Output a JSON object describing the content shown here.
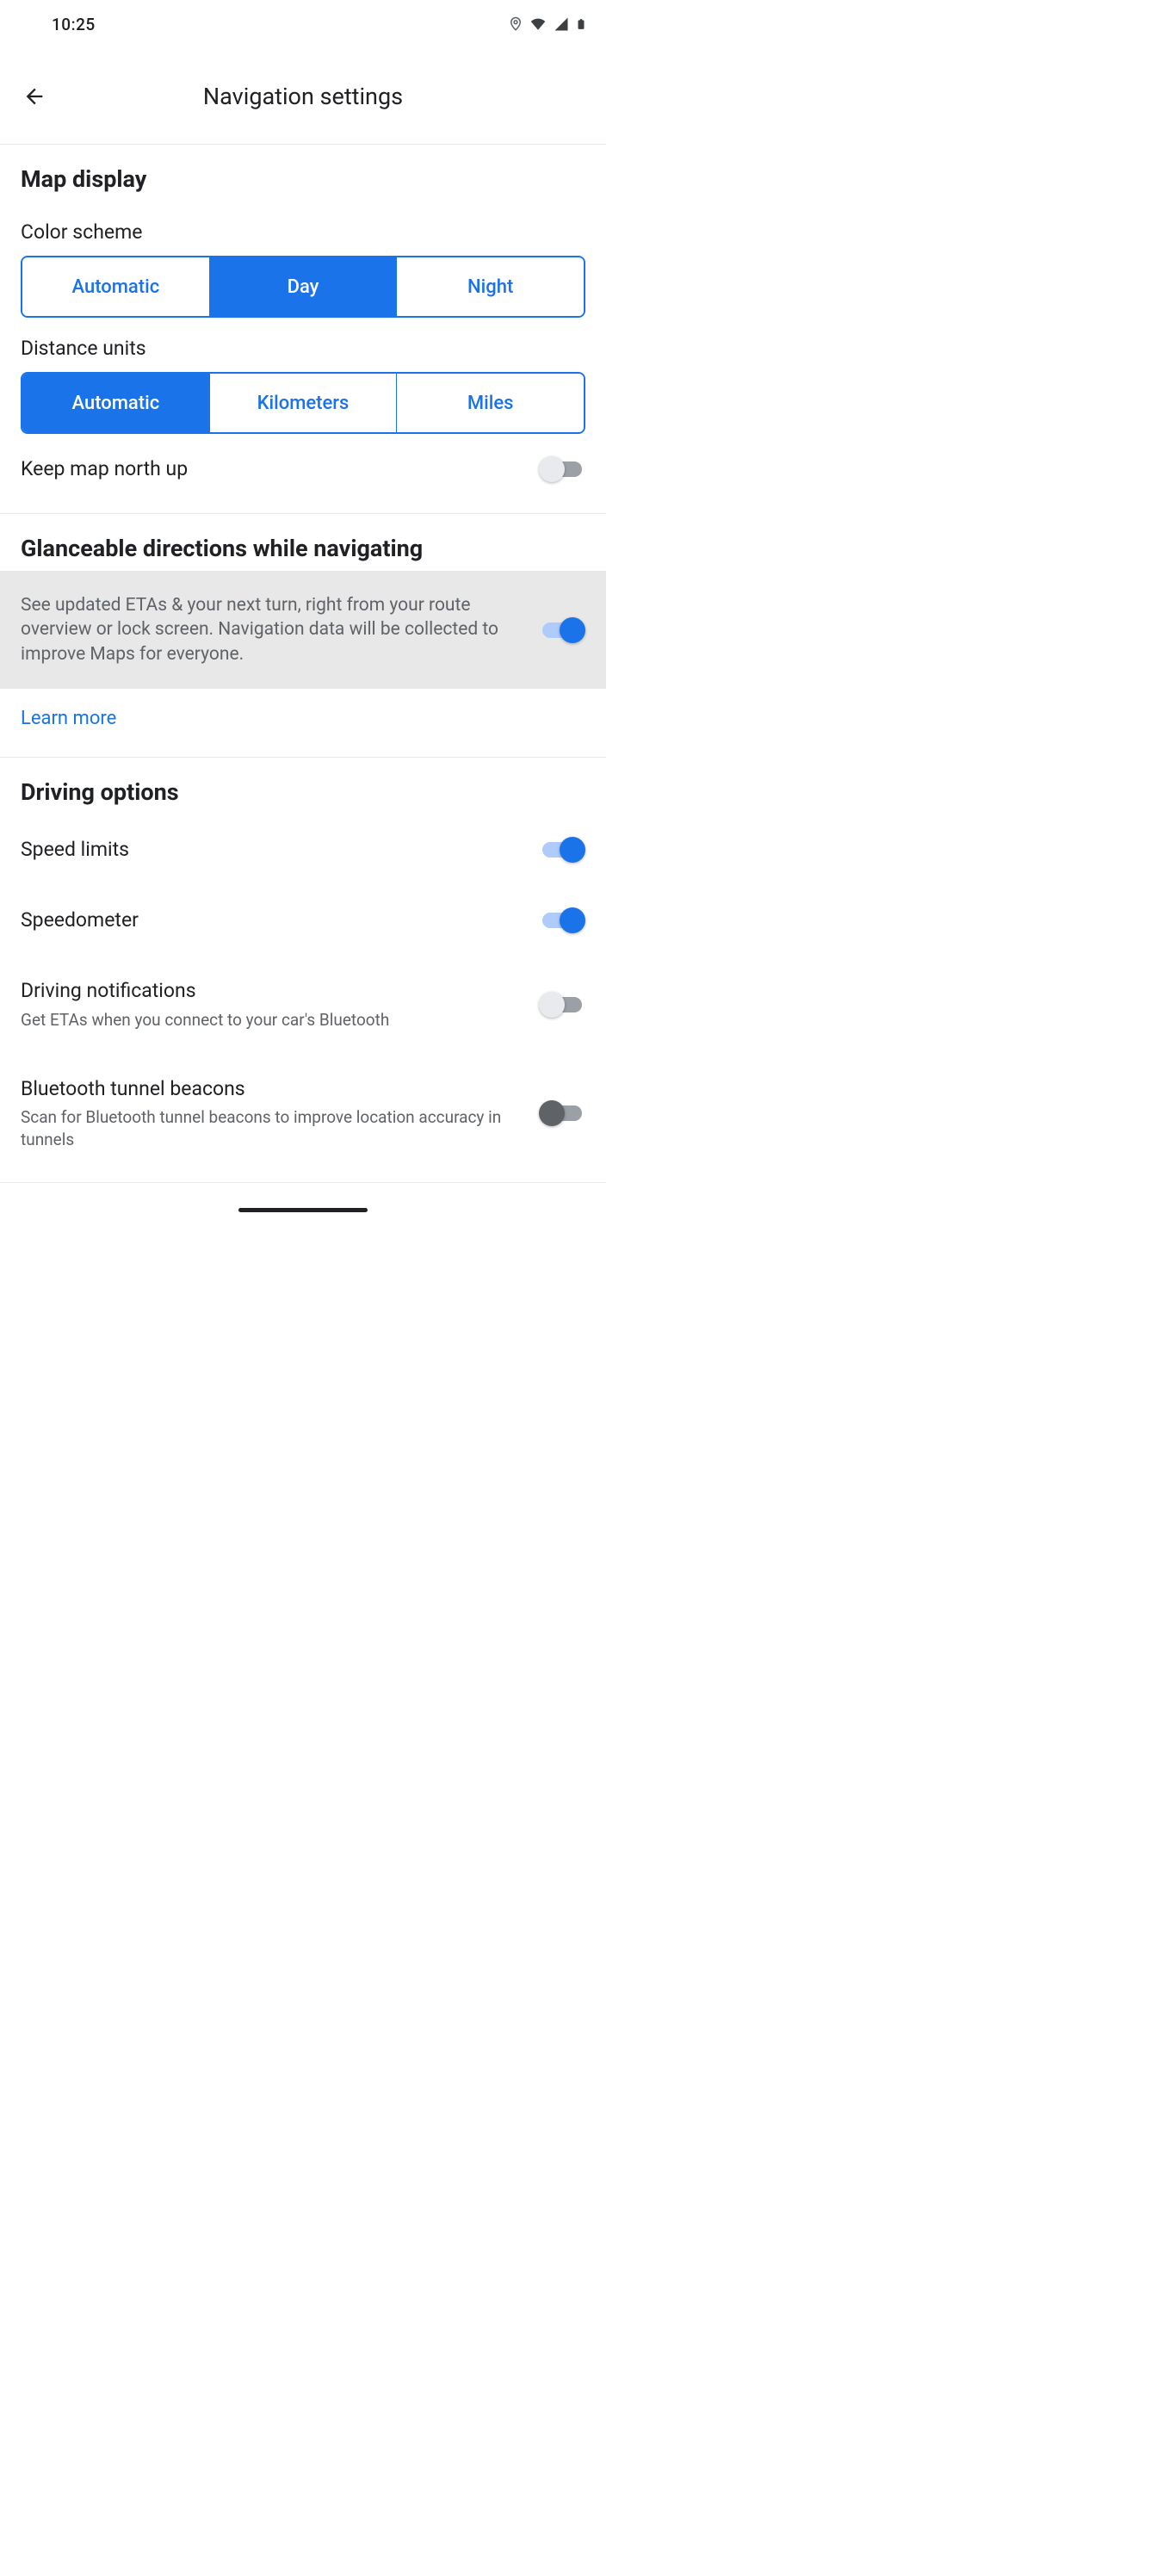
{
  "status": {
    "time": "10:25"
  },
  "appbar": {
    "title": "Navigation settings"
  },
  "map_display": {
    "header": "Map display",
    "color_scheme": {
      "label": "Color scheme",
      "options": [
        "Automatic",
        "Day",
        "Night"
      ],
      "selected": 1
    },
    "distance_units": {
      "label": "Distance units",
      "options": [
        "Automatic",
        "Kilometers",
        "Miles"
      ],
      "selected": 0
    },
    "keep_north": {
      "label": "Keep map north up",
      "on": false
    }
  },
  "glanceable": {
    "header": "Glanceable directions while navigating",
    "desc": "See updated ETAs & your next turn, right from your route overview or lock screen. Navigation data will be collected to improve Maps for everyone.",
    "on": true,
    "learn_more": "Learn more"
  },
  "driving": {
    "header": "Driving options",
    "speed_limits": {
      "label": "Speed limits",
      "on": true
    },
    "speedometer": {
      "label": "Speedometer",
      "on": true
    },
    "driving_notifications": {
      "label": "Driving notifications",
      "sub": "Get ETAs when you connect to your car's Bluetooth",
      "on": false
    },
    "bluetooth_beacons": {
      "label": "Bluetooth tunnel beacons",
      "sub": "Scan for Bluetooth tunnel beacons to improve location accuracy in tunnels",
      "on": false,
      "dark": true
    }
  }
}
